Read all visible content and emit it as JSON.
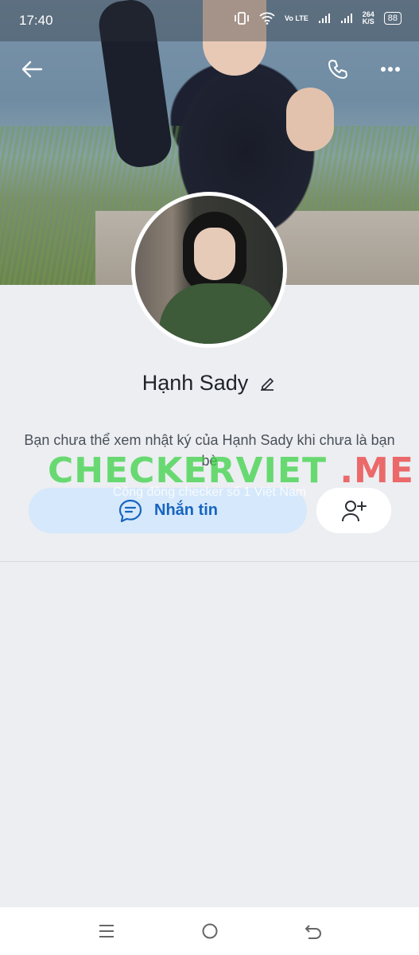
{
  "status_bar": {
    "time": "17:40",
    "network": "Vo LTE",
    "speed_value": "264",
    "speed_unit": "K/S",
    "battery": "88"
  },
  "profile": {
    "name": "Hạnh Sady",
    "diary_notice": "Bạn chưa thể xem nhật ký của Hạnh Sady khi chưa là bạn bè"
  },
  "actions": {
    "message_label": "Nhắn tin"
  },
  "watermark": {
    "main_green": "CHECKERVIET",
    "main_red": ".ME",
    "subtitle": "Cộng đồng checker số 1 Việt Nam"
  },
  "colors": {
    "accent": "#1565c0",
    "message_button_bg": "#d6e8fb",
    "page_bg": "#eceef2"
  },
  "icons": [
    "back-arrow-icon",
    "phone-icon",
    "more-icon",
    "edit-icon",
    "chat-icon",
    "add-friend-icon",
    "menu-icon",
    "home-icon",
    "back-icon"
  ]
}
